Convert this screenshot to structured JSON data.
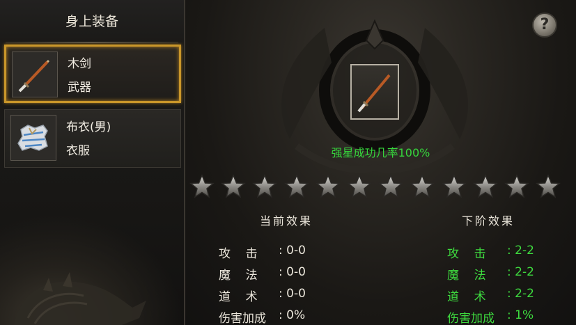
{
  "left_panel": {
    "title": "身上装备",
    "items": [
      {
        "name": "木剑",
        "type": "武器",
        "icon": "wooden-sword-icon",
        "selected": true
      },
      {
        "name": "布衣(男)",
        "type": "衣服",
        "icon": "cloth-armor-icon",
        "selected": false
      }
    ]
  },
  "upgrade": {
    "help_label": "?",
    "success_rate": "强星成功几率100%",
    "stars_total": 12,
    "stars_filled": 0
  },
  "current_effect": {
    "title": "当前效果",
    "stats": [
      {
        "label": "攻    击",
        "value": ": 0-0"
      },
      {
        "label": "魔    法",
        "value": ": 0-0"
      },
      {
        "label": "道    术",
        "value": ": 0-0"
      },
      {
        "label": "伤害加成",
        "value": ": 0%"
      }
    ]
  },
  "next_effect": {
    "title": "下阶效果",
    "stats": [
      {
        "label": "攻    击",
        "value": ": 2-2"
      },
      {
        "label": "魔    法",
        "value": ": 2-2"
      },
      {
        "label": "道    术",
        "value": ": 2-2"
      },
      {
        "label": "伤害加成",
        "value": ": 1%"
      }
    ]
  },
  "colors": {
    "accent_gold": "#c9962a",
    "success_green": "#36d63c",
    "stat_green": "#3edb3f",
    "text_light": "#ece7dc"
  }
}
